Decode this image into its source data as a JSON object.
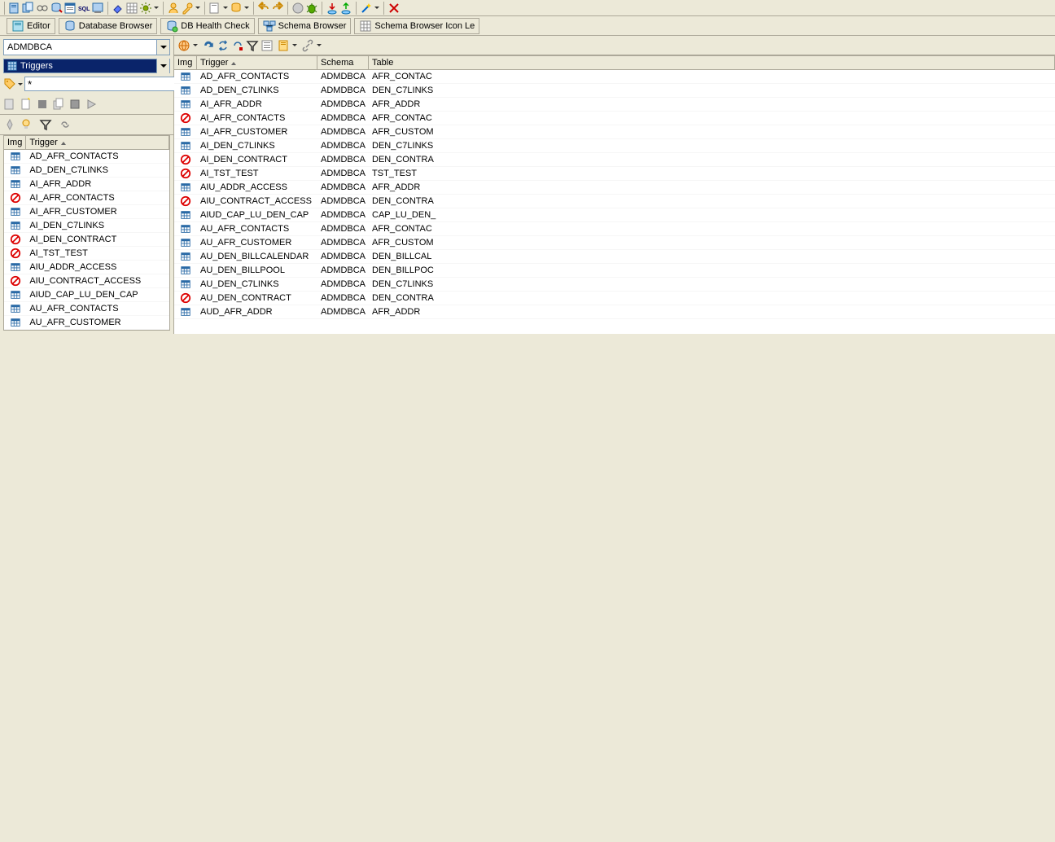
{
  "tabs": {
    "editor": "Editor",
    "db_browser": "Database Browser",
    "db_health": "DB Health Check",
    "schema_browser": "Schema Browser",
    "schema_browser_icon": "Schema Browser Icon Le"
  },
  "left": {
    "schema_combo": "ADMDBCA",
    "type_combo": "Triggers",
    "filter_value": "*",
    "cols": {
      "img": "Img",
      "trigger": "Trigger"
    },
    "rows": [
      {
        "icon": "grid",
        "name": "AD_AFR_CONTACTS"
      },
      {
        "icon": "grid",
        "name": "AD_DEN_C7LINKS"
      },
      {
        "icon": "grid",
        "name": "AI_AFR_ADDR"
      },
      {
        "icon": "disabled",
        "name": "AI_AFR_CONTACTS"
      },
      {
        "icon": "grid",
        "name": "AI_AFR_CUSTOMER"
      },
      {
        "icon": "grid",
        "name": "AI_DEN_C7LINKS"
      },
      {
        "icon": "disabled",
        "name": "AI_DEN_CONTRACT"
      },
      {
        "icon": "disabled",
        "name": "AI_TST_TEST"
      },
      {
        "icon": "grid",
        "name": "AIU_ADDR_ACCESS"
      },
      {
        "icon": "disabled",
        "name": "AIU_CONTRACT_ACCESS"
      },
      {
        "icon": "grid",
        "name": "AIUD_CAP_LU_DEN_CAP"
      },
      {
        "icon": "grid",
        "name": "AU_AFR_CONTACTS"
      },
      {
        "icon": "grid",
        "name": "AU_AFR_CUSTOMER"
      }
    ]
  },
  "right": {
    "cols": {
      "img": "Img",
      "trigger": "Trigger",
      "schema": "Schema",
      "table": "Table"
    },
    "rows": [
      {
        "icon": "grid",
        "name": "AD_AFR_CONTACTS",
        "schema": "ADMDBCA",
        "table": "AFR_CONTAC"
      },
      {
        "icon": "grid",
        "name": "AD_DEN_C7LINKS",
        "schema": "ADMDBCA",
        "table": "DEN_C7LINKS"
      },
      {
        "icon": "grid",
        "name": "AI_AFR_ADDR",
        "schema": "ADMDBCA",
        "table": "AFR_ADDR"
      },
      {
        "icon": "disabled",
        "name": "AI_AFR_CONTACTS",
        "schema": "ADMDBCA",
        "table": "AFR_CONTAC"
      },
      {
        "icon": "grid",
        "name": "AI_AFR_CUSTOMER",
        "schema": "ADMDBCA",
        "table": "AFR_CUSTOM"
      },
      {
        "icon": "grid",
        "name": "AI_DEN_C7LINKS",
        "schema": "ADMDBCA",
        "table": "DEN_C7LINKS"
      },
      {
        "icon": "disabled",
        "name": "AI_DEN_CONTRACT",
        "schema": "ADMDBCA",
        "table": "DEN_CONTRA"
      },
      {
        "icon": "disabled",
        "name": "AI_TST_TEST",
        "schema": "ADMDBCA",
        "table": "TST_TEST"
      },
      {
        "icon": "grid",
        "name": "AIU_ADDR_ACCESS",
        "schema": "ADMDBCA",
        "table": "AFR_ADDR"
      },
      {
        "icon": "disabled",
        "name": "AIU_CONTRACT_ACCESS",
        "schema": "ADMDBCA",
        "table": "DEN_CONTRA"
      },
      {
        "icon": "grid",
        "name": "AIUD_CAP_LU_DEN_CAP",
        "schema": "ADMDBCA",
        "table": "CAP_LU_DEN_"
      },
      {
        "icon": "grid",
        "name": "AU_AFR_CONTACTS",
        "schema": "ADMDBCA",
        "table": "AFR_CONTAC"
      },
      {
        "icon": "grid",
        "name": "AU_AFR_CUSTOMER",
        "schema": "ADMDBCA",
        "table": "AFR_CUSTOM"
      },
      {
        "icon": "grid",
        "name": "AU_DEN_BILLCALENDAR",
        "schema": "ADMDBCA",
        "table": "DEN_BILLCAL"
      },
      {
        "icon": "grid",
        "name": "AU_DEN_BILLPOOL",
        "schema": "ADMDBCA",
        "table": "DEN_BILLPOC"
      },
      {
        "icon": "grid",
        "name": "AU_DEN_C7LINKS",
        "schema": "ADMDBCA",
        "table": "DEN_C7LINKS"
      },
      {
        "icon": "disabled",
        "name": "AU_DEN_CONTRACT",
        "schema": "ADMDBCA",
        "table": "DEN_CONTRA"
      },
      {
        "icon": "grid",
        "name": "AUD_AFR_ADDR",
        "schema": "ADMDBCA",
        "table": "AFR_ADDR"
      }
    ]
  }
}
